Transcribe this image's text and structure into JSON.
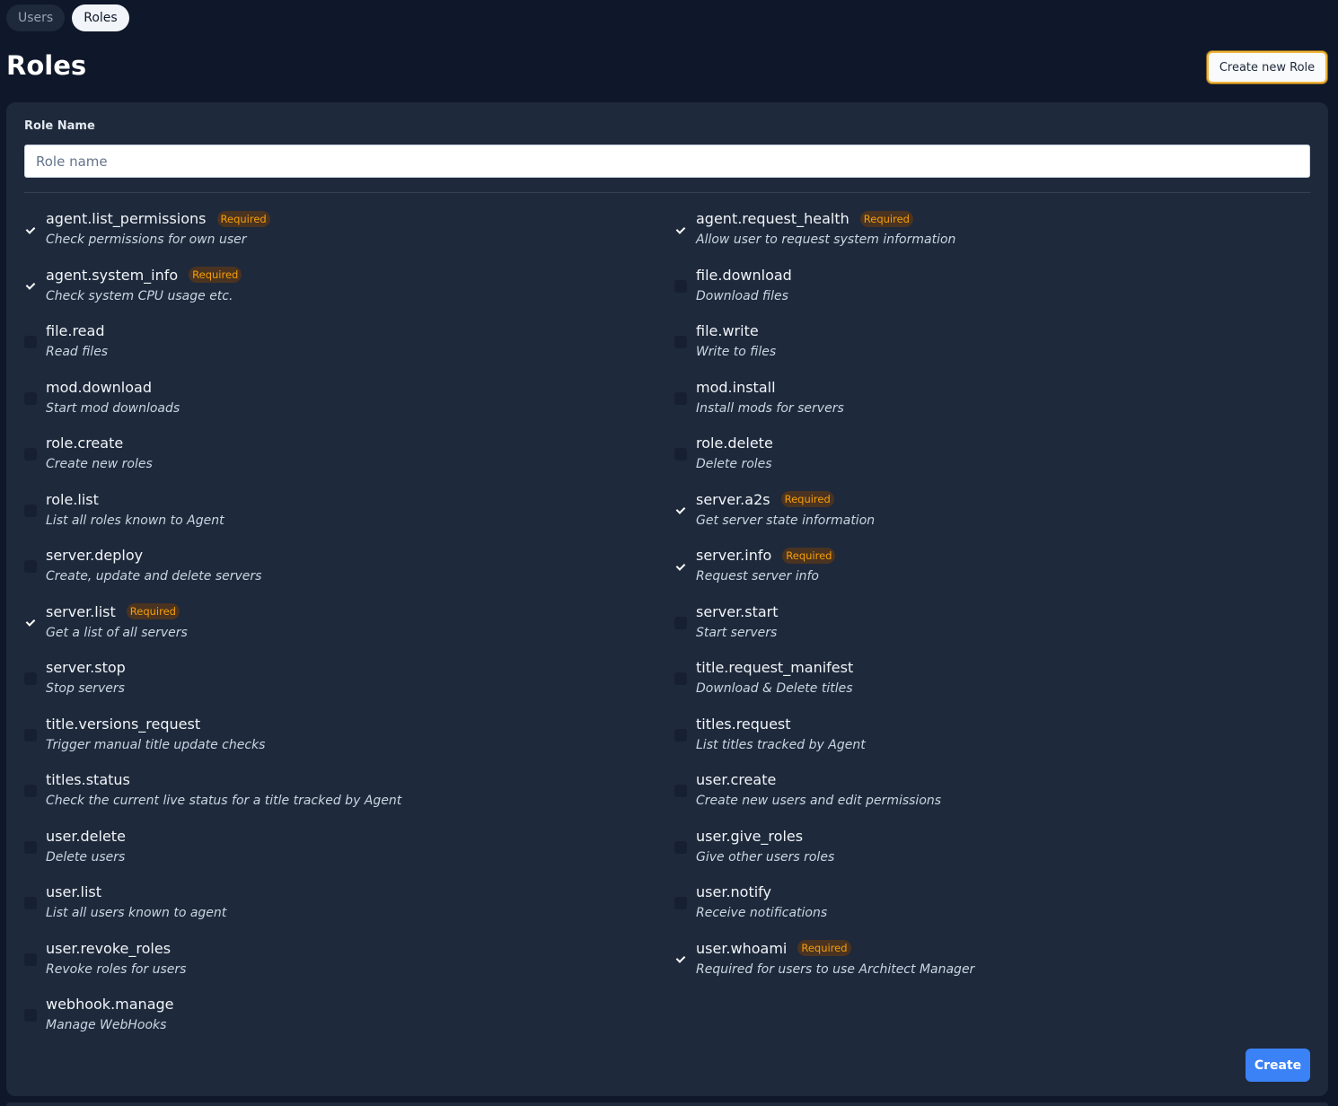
{
  "tabs": [
    {
      "label": "Users",
      "active": false
    },
    {
      "label": "Roles",
      "active": true
    }
  ],
  "page": {
    "title": "Roles",
    "create_new_role_label": "Create new Role"
  },
  "form": {
    "role_name_label": "Role Name",
    "role_name_placeholder": "Role name",
    "role_name_value": "",
    "required_badge": "Required",
    "create_label": "Create"
  },
  "permissions": [
    {
      "name": "agent.list_permissions",
      "description": "Check permissions for own user",
      "required": true,
      "checked": true
    },
    {
      "name": "agent.request_health",
      "description": "Allow user to request system information",
      "required": true,
      "checked": true
    },
    {
      "name": "agent.system_info",
      "description": "Check system CPU usage etc.",
      "required": true,
      "checked": true
    },
    {
      "name": "file.download",
      "description": "Download files",
      "required": false,
      "checked": false
    },
    {
      "name": "file.read",
      "description": "Read files",
      "required": false,
      "checked": false
    },
    {
      "name": "file.write",
      "description": "Write to files",
      "required": false,
      "checked": false
    },
    {
      "name": "mod.download",
      "description": "Start mod downloads",
      "required": false,
      "checked": false
    },
    {
      "name": "mod.install",
      "description": "Install mods for servers",
      "required": false,
      "checked": false
    },
    {
      "name": "role.create",
      "description": "Create new roles",
      "required": false,
      "checked": false
    },
    {
      "name": "role.delete",
      "description": "Delete roles",
      "required": false,
      "checked": false
    },
    {
      "name": "role.list",
      "description": "List all roles known to Agent",
      "required": false,
      "checked": false
    },
    {
      "name": "server.a2s",
      "description": "Get server state information",
      "required": true,
      "checked": true
    },
    {
      "name": "server.deploy",
      "description": "Create, update and delete servers",
      "required": false,
      "checked": false
    },
    {
      "name": "server.info",
      "description": "Request server info",
      "required": true,
      "checked": true
    },
    {
      "name": "server.list",
      "description": "Get a list of all servers",
      "required": true,
      "checked": true
    },
    {
      "name": "server.start",
      "description": "Start servers",
      "required": false,
      "checked": false
    },
    {
      "name": "server.stop",
      "description": "Stop servers",
      "required": false,
      "checked": false
    },
    {
      "name": "title.request_manifest",
      "description": "Download & Delete titles",
      "required": false,
      "checked": false
    },
    {
      "name": "title.versions_request",
      "description": "Trigger manual title update checks",
      "required": false,
      "checked": false
    },
    {
      "name": "titles.request",
      "description": "List titles tracked by Agent",
      "required": false,
      "checked": false
    },
    {
      "name": "titles.status",
      "description": "Check the current live status for a title tracked by Agent",
      "required": false,
      "checked": false
    },
    {
      "name": "user.create",
      "description": "Create new users and edit permissions",
      "required": false,
      "checked": false
    },
    {
      "name": "user.delete",
      "description": "Delete users",
      "required": false,
      "checked": false
    },
    {
      "name": "user.give_roles",
      "description": "Give other users roles",
      "required": false,
      "checked": false
    },
    {
      "name": "user.list",
      "description": "List all users known to agent",
      "required": false,
      "checked": false
    },
    {
      "name": "user.notify",
      "description": "Receive notifications",
      "required": false,
      "checked": false
    },
    {
      "name": "user.revoke_roles",
      "description": "Revoke roles for users",
      "required": false,
      "checked": false
    },
    {
      "name": "user.whoami",
      "description": "Required for users to use Architect Manager",
      "required": true,
      "checked": true
    },
    {
      "name": "webhook.manage",
      "description": "Manage WebHooks",
      "required": false,
      "checked": false
    }
  ]
}
